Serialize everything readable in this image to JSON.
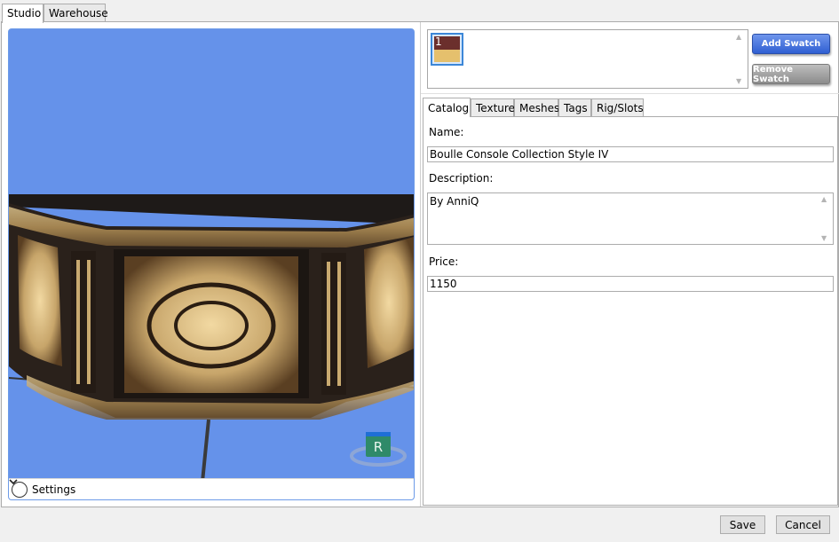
{
  "tabs": {
    "studio": "Studio",
    "warehouse": "Warehouse"
  },
  "viewport": {
    "settings_label": "Settings",
    "gizmo_letter": "R"
  },
  "swatches": {
    "items": [
      {
        "number": "1",
        "colors": [
          "#6b2f2c",
          "#e5c06d"
        ]
      }
    ]
  },
  "actions": {
    "add_swatch": "Add Swatch",
    "remove_swatch": "Remove Swatch"
  },
  "sub_tabs": {
    "catalog": "Catalog",
    "texture": "Texture",
    "meshes": "Meshes",
    "tags": "Tags",
    "rig_slots": "Rig/Slots"
  },
  "catalog": {
    "name_label": "Name:",
    "name_value": "Boulle Console Collection Style IV",
    "description_label": "Description:",
    "description_value": "By AnniQ",
    "price_label": "Price:",
    "price_value": "1150"
  },
  "footer": {
    "save": "Save",
    "cancel": "Cancel"
  },
  "colors": {
    "viewport_bg": "#6592ea",
    "accent_blue": "#2f5fd2"
  }
}
